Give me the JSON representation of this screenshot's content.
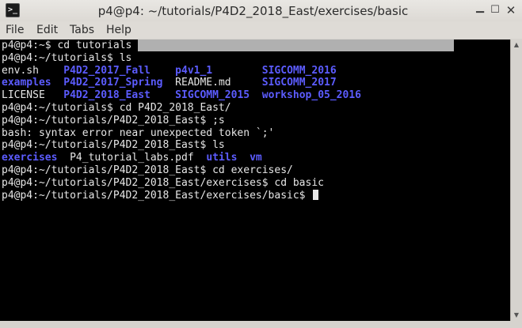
{
  "window": {
    "title": "p4@p4: ~/tutorials/P4D2_2018_East/exercises/basic",
    "app_icon_text": ">_"
  },
  "menu": {
    "file": "File",
    "edit": "Edit",
    "tabs": "Tabs",
    "help": "Help"
  },
  "terminal": {
    "line1_prompt": "p4@p4:~$ ",
    "line1_cmd": "cd tutorials",
    "line1_selection": "                                                   ",
    "line2": "p4@p4:~/tutorials$ ls",
    "ls1": {
      "row1": [
        "env.sh",
        "P4D2_2017_Fall",
        "p4v1_1",
        "SIGCOMM_2016"
      ],
      "row2": [
        "examples",
        "P4D2_2017_Spring",
        "README.md",
        "SIGCOMM_2017"
      ],
      "row3": [
        "LICENSE",
        "P4D2_2018_East",
        "SIGCOMM_2015",
        "workshop_05_2016"
      ]
    },
    "line6": "p4@p4:~/tutorials$ cd P4D2_2018_East/",
    "line7": "p4@p4:~/tutorials/P4D2_2018_East$ ;s",
    "line8": "bash: syntax error near unexpected token `;'",
    "line9": "p4@p4:~/tutorials/P4D2_2018_East$ ls",
    "ls2": [
      "exercises",
      "P4_tutorial_labs.pdf",
      "utils",
      "vm"
    ],
    "line11": "p4@p4:~/tutorials/P4D2_2018_East$ cd exercises/",
    "line12": "p4@p4:~/tutorials/P4D2_2018_East/exercises$ cd basic",
    "line13": "p4@p4:~/tutorials/P4D2_2018_East/exercises/basic$ "
  },
  "colors": {
    "directory": "#5c5cff",
    "text": "#e6e6e6",
    "background": "#000000"
  }
}
